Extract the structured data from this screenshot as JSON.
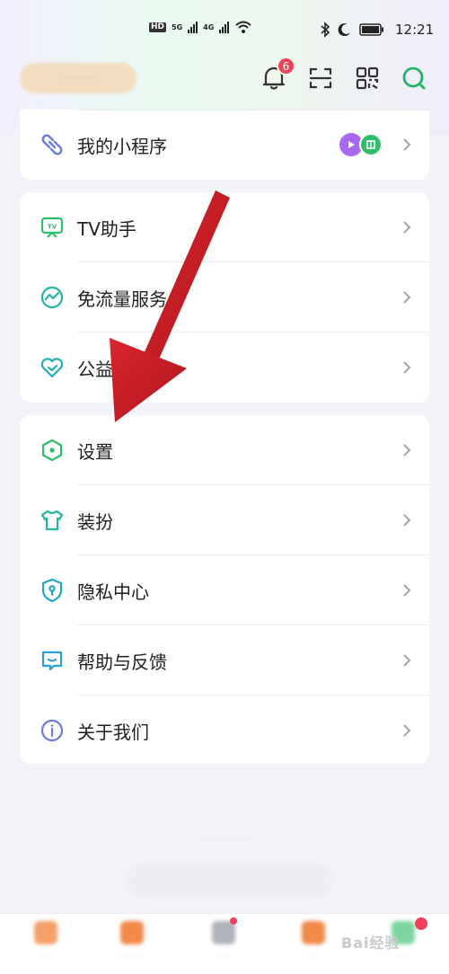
{
  "status_bar": {
    "hd": "HD",
    "net_1": "5G",
    "net_2": "4G",
    "time": "12:21"
  },
  "header": {
    "notification_count": "6",
    "icons": [
      "bell-icon",
      "scan-icon",
      "qr-code-icon",
      "search-icon"
    ]
  },
  "card_mini": {
    "label": "我的小程序"
  },
  "card_services": {
    "items": [
      {
        "label": "TV助手",
        "icon": "tv-icon"
      },
      {
        "label": "免流量服务",
        "icon": "traffic-icon"
      },
      {
        "label": "公益",
        "icon": "charity-heart-icon"
      }
    ]
  },
  "card_settings": {
    "items": [
      {
        "label": "设置",
        "icon": "hexagon-settings-icon"
      },
      {
        "label": "装扮",
        "icon": "shirt-icon"
      },
      {
        "label": "隐私中心",
        "icon": "shield-icon"
      },
      {
        "label": "帮助与反馈",
        "icon": "feedback-icon"
      },
      {
        "label": "关于我们",
        "icon": "info-icon"
      }
    ]
  },
  "watermark": "Bai经验",
  "colors": {
    "accent_green": "#2ebd6a",
    "badge_red": "#f0405a",
    "arrow_red": "#c8202a"
  }
}
